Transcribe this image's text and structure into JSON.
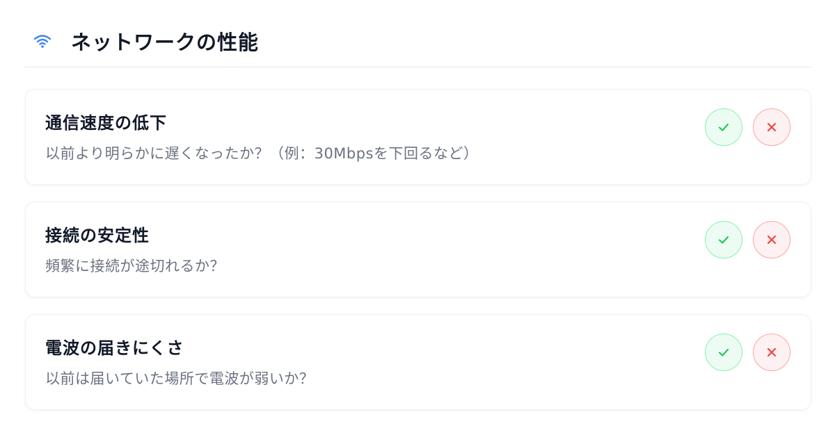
{
  "section": {
    "title": "ネットワークの性能",
    "icon": "wifi-icon",
    "accent": "#3b82f6"
  },
  "items": [
    {
      "title": "通信速度の低下",
      "description": "以前より明らかに遅くなったか？（例：30Mbpsを下回るなど）"
    },
    {
      "title": "接続の安定性",
      "description": "頻繁に接続が途切れるか？"
    },
    {
      "title": "電波の届きにくさ",
      "description": "以前は届いていた場所で電波が弱いか？"
    }
  ],
  "actions": {
    "yes_icon": "check-icon",
    "no_icon": "x-icon",
    "yes_color": "#22c55e",
    "no_color": "#ef4444"
  }
}
